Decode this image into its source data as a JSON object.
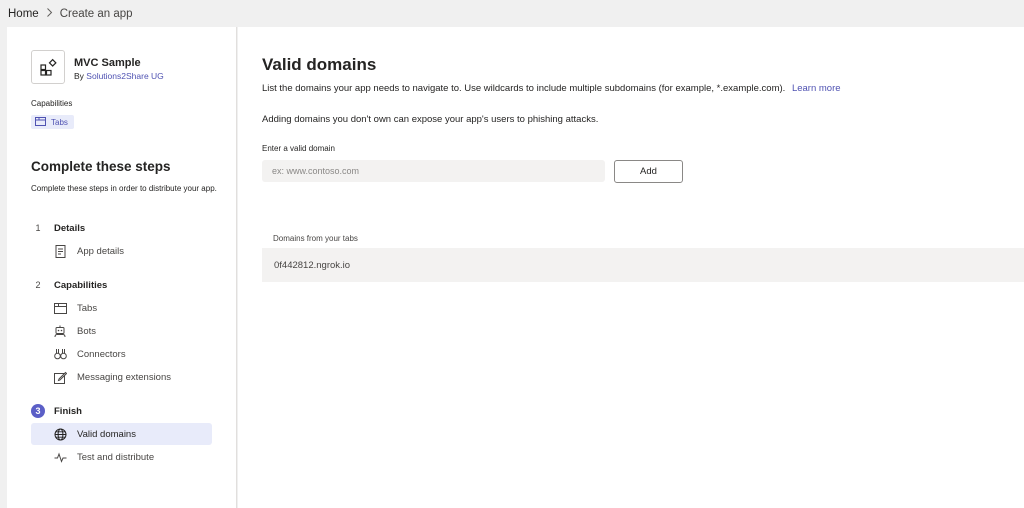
{
  "breadcrumb": {
    "home": "Home",
    "separator": ">",
    "current": "Create an app"
  },
  "app": {
    "name": "MVC Sample",
    "by_prefix": "By",
    "developer": "Solutions2Share UG",
    "icon": "app-tile-icon",
    "capabilities_label": "Capabilities",
    "capability_chip": {
      "label": "Tabs",
      "icon": "tab-window-icon"
    }
  },
  "steps": {
    "title": "Complete these steps",
    "description": "Complete these steps in order to distribute your app.",
    "sections": [
      {
        "number": "1",
        "title": "Details",
        "items": [
          {
            "label": "App details",
            "icon": "document-icon",
            "selected": false
          }
        ]
      },
      {
        "number": "2",
        "title": "Capabilities",
        "items": [
          {
            "label": "Tabs",
            "icon": "tab-window-icon",
            "selected": false
          },
          {
            "label": "Bots",
            "icon": "bot-icon",
            "selected": false
          },
          {
            "label": "Connectors",
            "icon": "connector-icon",
            "selected": false
          },
          {
            "label": "Messaging extensions",
            "icon": "edit-icon",
            "selected": false
          }
        ]
      },
      {
        "number": "3",
        "title": "Finish",
        "active": true,
        "items": [
          {
            "label": "Valid domains",
            "icon": "globe-icon",
            "selected": true
          },
          {
            "label": "Test and distribute",
            "icon": "pulse-icon",
            "selected": false
          }
        ]
      }
    ]
  },
  "main": {
    "title": "Valid domains",
    "description": "List the domains your app needs to navigate to. Use wildcards to include multiple subdomains (for example, *.example.com).",
    "learn_more": "Learn more",
    "warning": "Adding domains you don't own can expose your app's users to phishing attacks.",
    "input_label": "Enter a valid domain",
    "input_placeholder": "ex: www.contoso.com",
    "input_value": "",
    "add_button": "Add",
    "tabs_domains_label": "Domains from your tabs",
    "tabs_domains": [
      "0f442812.ngrok.io"
    ]
  },
  "colors": {
    "accent": "#5b5fc7",
    "link": "#4f52b2",
    "selected_bg": "#e8ebfa",
    "app_background": "#f0f0f0",
    "field_background": "#f3f2f1"
  }
}
